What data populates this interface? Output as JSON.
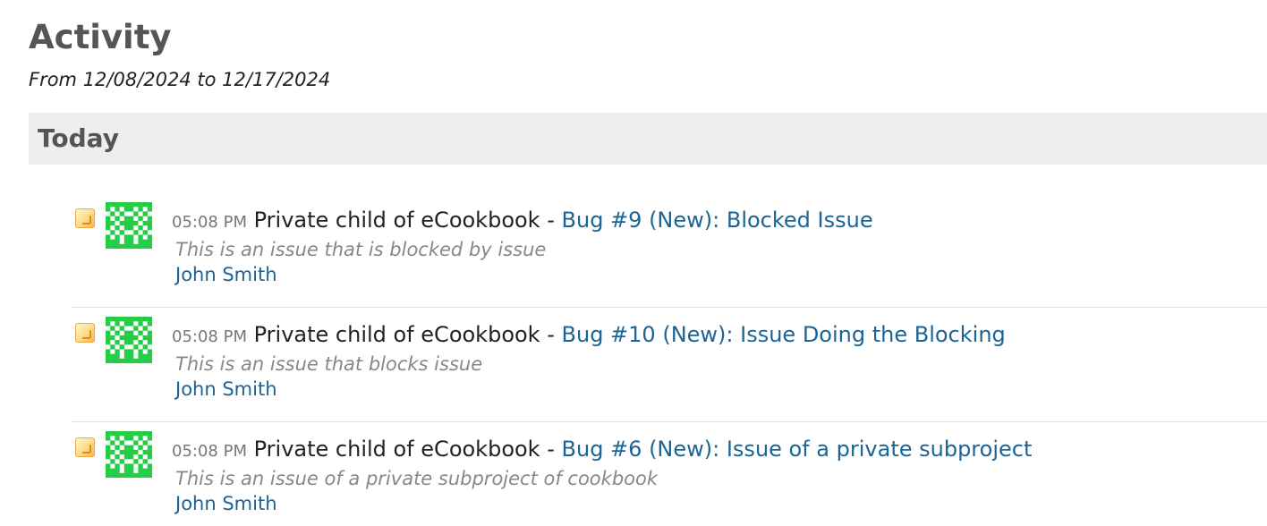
{
  "page": {
    "title": "Activity",
    "date_range": "From 12/08/2024 to 12/17/2024"
  },
  "day": {
    "label": "Today"
  },
  "colors": {
    "link": "#1a6496",
    "avatar": "#22cc44",
    "header_bg": "#eeeeee"
  },
  "events": [
    {
      "icon": "issue-icon",
      "avatar": "user-avatar",
      "time": "05:08 PM",
      "project": "Private child of eCookbook",
      "separator": " - ",
      "link": "Bug #9 (New): Blocked Issue",
      "description": "This is an issue that is blocked by issue",
      "author": "John Smith"
    },
    {
      "icon": "issue-icon",
      "avatar": "user-avatar",
      "time": "05:08 PM",
      "project": "Private child of eCookbook",
      "separator": " - ",
      "link": "Bug #10 (New): Issue Doing the Blocking",
      "description": "This is an issue that blocks issue",
      "author": "John Smith"
    },
    {
      "icon": "issue-icon",
      "avatar": "user-avatar",
      "time": "05:08 PM",
      "project": "Private child of eCookbook",
      "separator": " - ",
      "link": "Bug #6 (New): Issue of a private subproject",
      "description": "This is an issue of a private subproject of cookbook",
      "author": "John Smith"
    }
  ]
}
